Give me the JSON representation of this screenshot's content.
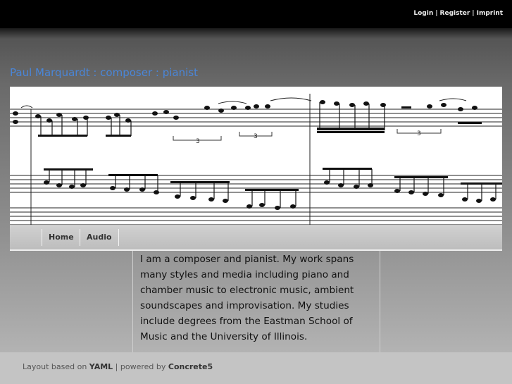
{
  "top_links": {
    "login": "Login",
    "sep1": "|",
    "register": "Register",
    "sep2": "|",
    "imprint": "Imprint"
  },
  "site_title": "Paul Marquardt : composer : pianist",
  "banner": {
    "description": "musical score excerpt image"
  },
  "nav": {
    "items": [
      "Home",
      "Audio"
    ]
  },
  "content": {
    "text": "I am a composer and pianist. My work spans many styles and media including piano and chamber music to electronic music, ambient soundscapes and improvisation. My studies include degrees from the Eastman School of Music and the University of Illinois."
  },
  "footer": {
    "prefix": "Layout based on ",
    "yaml": "YAML",
    "mid": " | powered by ",
    "concrete": "Concrete5"
  }
}
